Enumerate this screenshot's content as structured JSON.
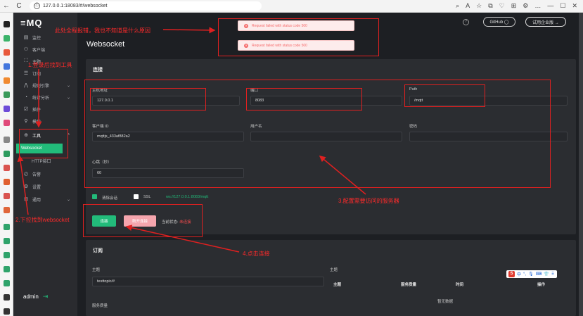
{
  "browser": {
    "url": "127.0.0.1:18083/#/websocket",
    "nav_back": "←",
    "nav_reload": "C",
    "info_icon": "ⓘ",
    "toolbar_icons": [
      "⌕",
      "A",
      "☆",
      "⧉",
      "♡",
      "⊞",
      "⚙",
      "…",
      "—",
      "☐",
      "✕"
    ]
  },
  "app": {
    "logo": "≡MQ",
    "admin": "admin",
    "logout_icon": "⇥"
  },
  "sidebar": {
    "items": [
      {
        "label": "监控",
        "icon": "▤"
      },
      {
        "label": "客户端",
        "icon": "⚇"
      },
      {
        "label": "主题",
        "icon": "⛶"
      },
      {
        "label": "订阅",
        "icon": "☰"
      },
      {
        "label": "规则引擎",
        "icon": "⋀",
        "arrow": "⌄"
      },
      {
        "label": "统计分析",
        "icon": "◔",
        "arrow": "⌄"
      },
      {
        "label": "插件",
        "icon": "☑"
      },
      {
        "label": "模块",
        "icon": "⚲"
      },
      {
        "label": "工具",
        "icon": "⊕",
        "arrow": "⌃"
      },
      {
        "label": "HTTP接口",
        "icon": ""
      },
      {
        "label": "告警",
        "icon": "◴"
      },
      {
        "label": "设置",
        "icon": "⚙"
      },
      {
        "label": "通用",
        "icon": "⊞",
        "arrow": "⌄"
      }
    ],
    "active_sub": "Websocket"
  },
  "topbar": {
    "help_icon": "?",
    "github": "GitHub ◯",
    "trial": "试用企业版 →"
  },
  "page": {
    "title": "Websocket"
  },
  "toasts": [
    "Request failed with status code 500",
    "Request failed with status code 500"
  ],
  "connection": {
    "title": "连接",
    "host_label": "主机地址",
    "host": "127.0.0.1",
    "port_label": "端口",
    "port": "8083",
    "path_label": "Path",
    "path": "/mqtt",
    "clientid_label": "客户端 ID",
    "clientid": "mqttjs_433af882a2",
    "username_label": "用户名",
    "username": "",
    "password_label": "密码",
    "password": "",
    "keepalive_label": "心跳（秒）",
    "keepalive": "60",
    "clean_session_label": "清除会话",
    "ssl_label": "SSL",
    "ws_url": "ws://127.0.0.1:8083/mqtt",
    "connect_btn": "连接",
    "disconnect_btn": "断开连接",
    "status_label": "当前状态:",
    "status_value": "未连接"
  },
  "subscribe": {
    "title": "订阅",
    "topic_label": "主题",
    "topic": "testtopic/#",
    "qos_label": "服务质量",
    "right_topic_label": "主题",
    "cols": [
      "主题",
      "服务质量",
      "时间",
      "操作"
    ],
    "empty": "暂无数据"
  },
  "annotations": {
    "a1": "此处全程报错，我也不知道是什么原因",
    "a2": "1.登录后找到工具",
    "a3": "2.下拉找到websocket",
    "a4": "3.配置需要访问的服务器",
    "a5": "4.点击连接"
  },
  "ime": {
    "logo": "S",
    "items": [
      "中",
      "°,",
      "🎙",
      "⌨",
      "👕",
      "⠿"
    ]
  },
  "colors": {
    "accent": "#22bb7a",
    "error": "#ff4d4f",
    "annotation": "#ff2a2a",
    "bg": "#1d1f23",
    "sidebar": "#2a2b2f"
  }
}
